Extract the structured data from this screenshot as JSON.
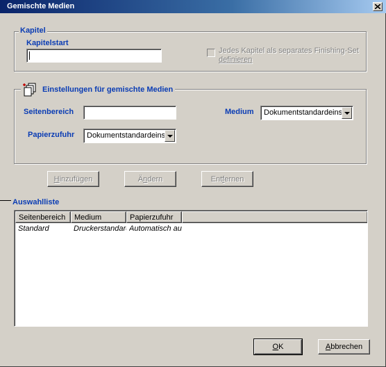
{
  "window": {
    "title": "Gemischte Medien"
  },
  "chapter": {
    "group_label": "Kapitel",
    "start_label": "Kapitelstart",
    "start_value": "",
    "checkbox_label_line1": "Jedes Kapitel als separates Finishing-Set",
    "checkbox_label_line2": "definieren",
    "checkbox_checked": false,
    "checkbox_enabled": false
  },
  "settings": {
    "group_label": "Einstellungen für gemischte Medien",
    "page_range_label": "Seitenbereich",
    "page_range_value": "",
    "medium_label": "Medium",
    "medium_value": "Dokumentstandardeinst",
    "paper_source_label": "Papierzufuhr",
    "paper_source_value": "Dokumentstandardeinst"
  },
  "actions": {
    "add": {
      "pre": "",
      "key": "H",
      "post": "inzufügen",
      "enabled": false
    },
    "change": {
      "pre": "Ä",
      "key": "n",
      "post": "dern",
      "enabled": false
    },
    "remove": {
      "pre": "Ent",
      "key": "f",
      "post": "ernen",
      "enabled": false
    }
  },
  "selection_list": {
    "label": "Auswahlliste",
    "columns": [
      "Seitenbereich",
      "Medium",
      "Papierzufuhr"
    ],
    "rows": [
      [
        "Standard",
        "Druckerstandard",
        "Automatisch auswählen"
      ]
    ]
  },
  "footer": {
    "ok": {
      "key": "O",
      "post": "K"
    },
    "cancel": {
      "key": "A",
      "post": "bbrechen"
    }
  },
  "colors": {
    "label_blue": "#0a3cb4",
    "titlebar": "#0a246a",
    "dialog_bg": "#d4d0c8"
  },
  "icons": {
    "close": "close-icon",
    "pages": "stacked-pages-icon"
  }
}
